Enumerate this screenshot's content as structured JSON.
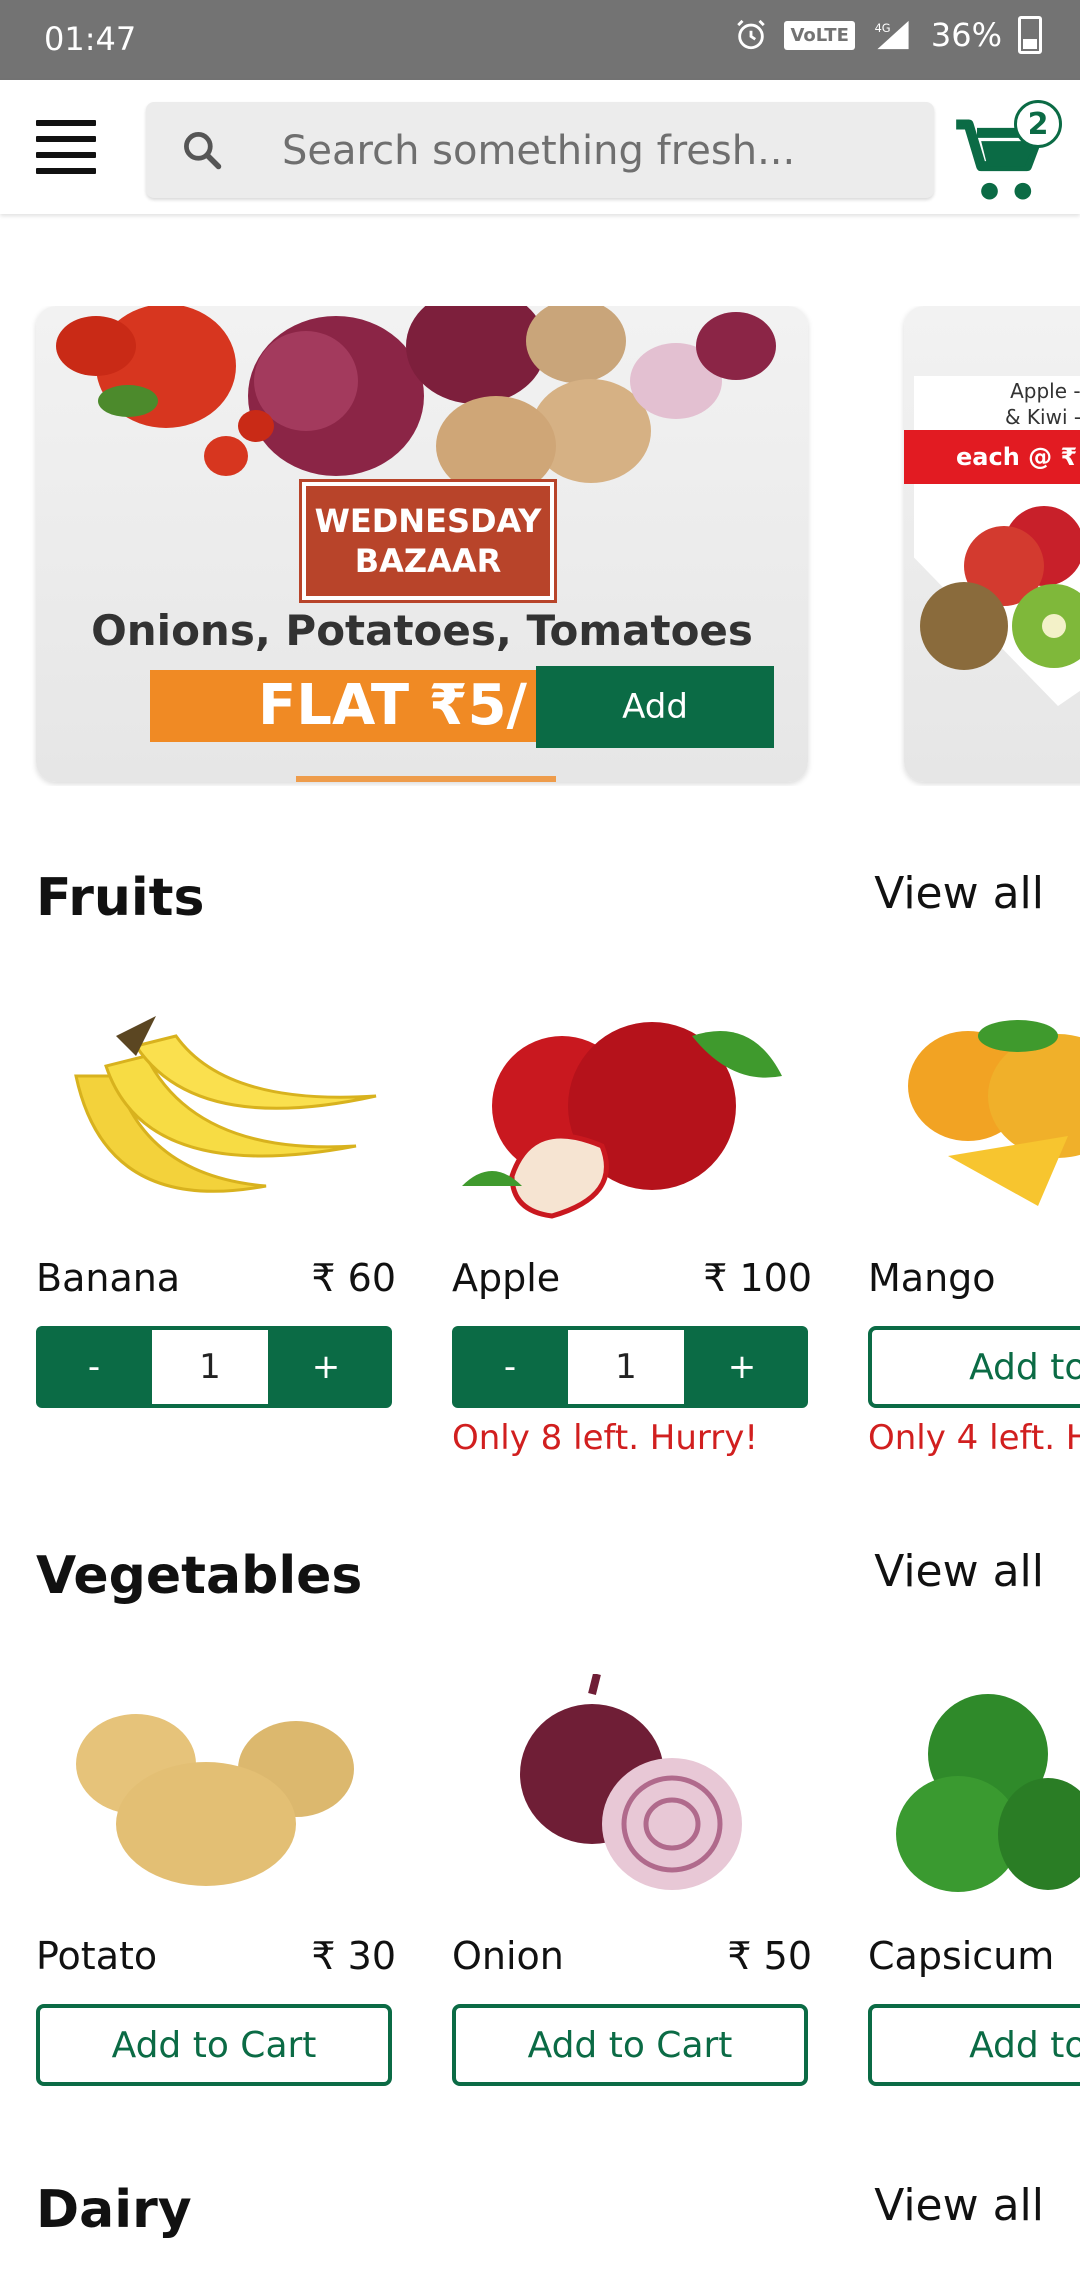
{
  "status_bar": {
    "time": "01:47",
    "network": "VoLTE",
    "signal": "4G",
    "battery": "36%"
  },
  "app_bar": {
    "search_placeholder": "Search something fresh...",
    "cart_count": "2"
  },
  "banners": [
    {
      "badge_line1": "WEDNESDAY",
      "badge_line2": "BAZAAR",
      "headline": "Onions, Potatoes, Tomatoes",
      "offer": "FLAT ₹5/",
      "button": "Add"
    },
    {
      "text_line1": "Apple - Shi",
      "text_line2": "& Kiwi - Gre",
      "red_text": "each @ ₹"
    }
  ],
  "sections": [
    {
      "title": "Fruits",
      "view_all": "View all",
      "products": [
        {
          "name": "Banana",
          "price": "₹ 60",
          "qty": "1",
          "stock": ""
        },
        {
          "name": "Apple",
          "price": "₹ 100",
          "qty": "1",
          "stock": "Only 8 left. Hurry!"
        },
        {
          "name": "Mango",
          "price": "",
          "action": "Add to C",
          "stock": "Only 4 left. H"
        }
      ]
    },
    {
      "title": "Vegetables",
      "view_all": "View all",
      "products": [
        {
          "name": "Potato",
          "price": "₹ 30",
          "action": "Add to Cart"
        },
        {
          "name": "Onion",
          "price": "₹ 50",
          "action": "Add to Cart"
        },
        {
          "name": "Capsicum",
          "price": "",
          "action": "Add to C"
        }
      ]
    },
    {
      "title": "Dairy",
      "view_all": "View all"
    }
  ],
  "stepper": {
    "minus": "-",
    "plus": "+"
  },
  "colors": {
    "brand_green": "#0b6b45",
    "alert_red": "#d11f1f",
    "status_gray": "#737373"
  }
}
